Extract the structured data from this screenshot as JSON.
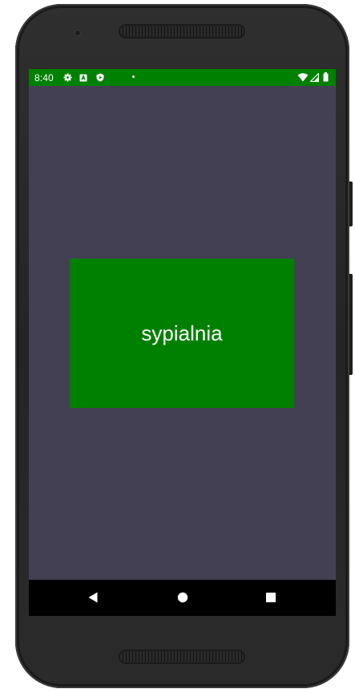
{
  "status_bar": {
    "time": "8:40",
    "background_color": "#008000",
    "left_icons": [
      "gear-icon",
      "a-icon",
      "shield-icon",
      "dot-icon"
    ],
    "right_icons": [
      "wifi-icon",
      "signal-icon",
      "battery-icon"
    ]
  },
  "screen": {
    "background_color": "#444054"
  },
  "room_card": {
    "label": "sypialnia",
    "background_color": "#008000"
  },
  "nav_bar": {
    "buttons": [
      "back-icon",
      "home-icon",
      "recents-icon"
    ]
  }
}
